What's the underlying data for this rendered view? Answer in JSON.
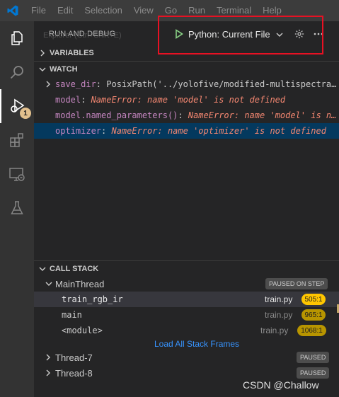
{
  "menu": [
    "File",
    "Edit",
    "Selection",
    "View",
    "Go",
    "Run",
    "Terminal",
    "Help"
  ],
  "activity": {
    "items": [
      "explorer-icon",
      "search-icon",
      "run-debug-icon",
      "extensions-icon",
      "remote-explorer-icon",
      "testing-icon"
    ],
    "debug_badge": "1"
  },
  "debug": {
    "title": "RUN AND DEBUG",
    "ghost_tip": "Explorer (Ctrl+Shift+E)",
    "config_name": "Python: Current File"
  },
  "sections": {
    "variables": "VARIABLES",
    "watch": "WATCH",
    "call_stack": "CALL STACK"
  },
  "watch": [
    {
      "name": "save_dir",
      "value": "PosixPath('../yolofive/modified-multispectra…",
      "error": false
    },
    {
      "name": "model",
      "value": "NameError: name 'model' is not defined",
      "error": true
    },
    {
      "name": "model.named_parameters()",
      "value": "NameError: name 'model' is n…",
      "error": true
    },
    {
      "name": "optimizer",
      "value": "NameError: name 'optimizer' is not defined",
      "error": true
    }
  ],
  "call_stack": {
    "main_thread": {
      "name": "MainThread",
      "status": "PAUSED ON STEP"
    },
    "frames": [
      {
        "name": "train_rgb_ir",
        "file": "train.py",
        "line": "505:1"
      },
      {
        "name": "main",
        "file": "train.py",
        "line": "965:1"
      },
      {
        "name": "<module>",
        "file": "train.py",
        "line": "1068:1"
      }
    ],
    "load_all": "Load All Stack Frames",
    "threads": [
      {
        "name": "Thread-7",
        "status": "PAUSED"
      },
      {
        "name": "Thread-8",
        "status": "PAUSED"
      }
    ]
  },
  "watermark": "CSDN @Challow",
  "colors": {
    "accent_blue": "#3794ff",
    "error_text": "#f48771",
    "line_badge_active": "#ffc600",
    "line_badge_dim": "#b89500",
    "highlight_box": "#e81123"
  }
}
